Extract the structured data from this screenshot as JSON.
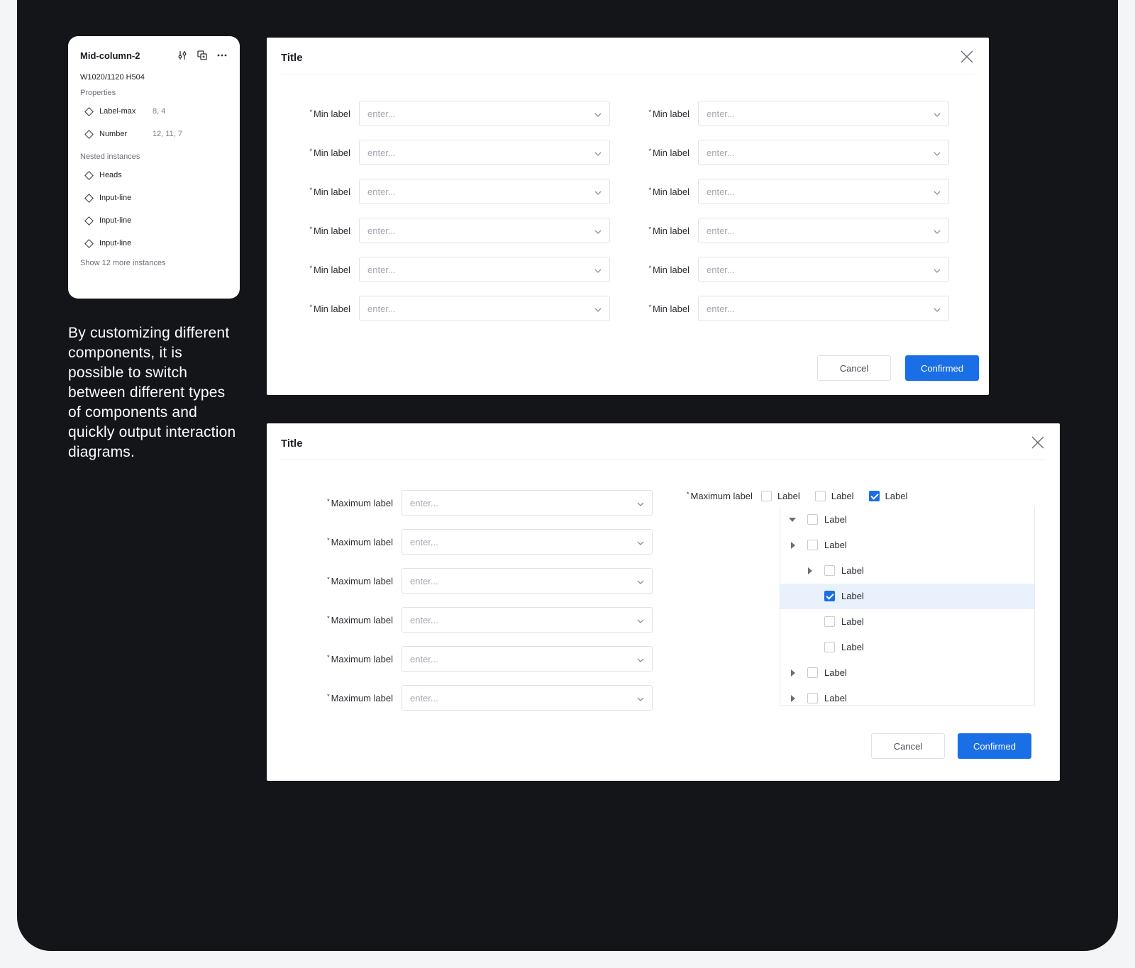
{
  "panel": {
    "title": "Mid-column-2",
    "dimensions": "W1020/1120 H504",
    "properties_heading": "Properties",
    "properties": [
      {
        "name": "Label-max",
        "value": "8, 4"
      },
      {
        "name": "Number",
        "value": "12, 11, 7"
      }
    ],
    "nested_heading": "Nested instances",
    "nested": [
      "Heads",
      "Input-line",
      "Input-line",
      "Input-line"
    ],
    "show_more": "Show 12 more instances"
  },
  "description": "By customizing different components, it is possible to switch between different types of components and quickly output interaction diagrams.",
  "dialog1": {
    "title": "Title",
    "required_mark": "*",
    "left_fields": [
      {
        "label": "Min label",
        "placeholder": "enter..."
      },
      {
        "label": "Min label",
        "placeholder": "enter..."
      },
      {
        "label": "Min label",
        "placeholder": "enter..."
      },
      {
        "label": "Min label",
        "placeholder": "enter..."
      },
      {
        "label": "Min label",
        "placeholder": "enter..."
      },
      {
        "label": "Min label",
        "placeholder": "enter..."
      }
    ],
    "right_fields": [
      {
        "label": "Min label",
        "placeholder": "enter..."
      },
      {
        "label": "Min label",
        "placeholder": "enter..."
      },
      {
        "label": "Min label",
        "placeholder": "enter..."
      },
      {
        "label": "Min label",
        "placeholder": "enter..."
      },
      {
        "label": "Min label",
        "placeholder": "enter..."
      },
      {
        "label": "Min label",
        "placeholder": "enter..."
      }
    ],
    "cancel": "Cancel",
    "confirm": "Confirmed"
  },
  "dialog2": {
    "title": "Title",
    "required_mark": "*",
    "fields": [
      {
        "label": "Maximum label",
        "placeholder": "enter..."
      },
      {
        "label": "Maximum label",
        "placeholder": "enter..."
      },
      {
        "label": "Maximum label",
        "placeholder": "enter..."
      },
      {
        "label": "Maximum label",
        "placeholder": "enter..."
      },
      {
        "label": "Maximum label",
        "placeholder": "enter..."
      },
      {
        "label": "Maximum label",
        "placeholder": "enter..."
      }
    ],
    "checkbox_group": {
      "label": "Maximum label",
      "options": [
        {
          "label": "Label",
          "checked": false
        },
        {
          "label": "Label",
          "checked": false
        },
        {
          "label": "Label",
          "checked": true
        }
      ]
    },
    "tree": [
      {
        "label": "Label",
        "level": 0,
        "arrow": "down",
        "checked": false,
        "selected": false
      },
      {
        "label": "Label",
        "level": 0,
        "arrow": "right",
        "checked": false,
        "selected": false
      },
      {
        "label": "Label",
        "level": 1,
        "arrow": "right",
        "checked": false,
        "selected": false
      },
      {
        "label": "Label",
        "level": 1,
        "arrow": "none",
        "checked": true,
        "selected": true
      },
      {
        "label": "Label",
        "level": 1,
        "arrow": "none",
        "checked": false,
        "selected": false
      },
      {
        "label": "Label",
        "level": 1,
        "arrow": "none",
        "checked": false,
        "selected": false
      },
      {
        "label": "Label",
        "level": 0,
        "arrow": "right",
        "checked": false,
        "selected": false
      },
      {
        "label": "Label",
        "level": 0,
        "arrow": "right",
        "checked": false,
        "selected": false
      }
    ],
    "cancel": "Cancel",
    "confirm": "Confirmed"
  },
  "colors": {
    "primary": "#1a6ee6",
    "background": "#141519",
    "selected_row": "#e9f1fc"
  },
  "icons": [
    "tune-icon",
    "component-swap-icon",
    "more-icon",
    "close-icon",
    "chevron-down-icon",
    "caret-down-icon",
    "caret-right-icon"
  ]
}
